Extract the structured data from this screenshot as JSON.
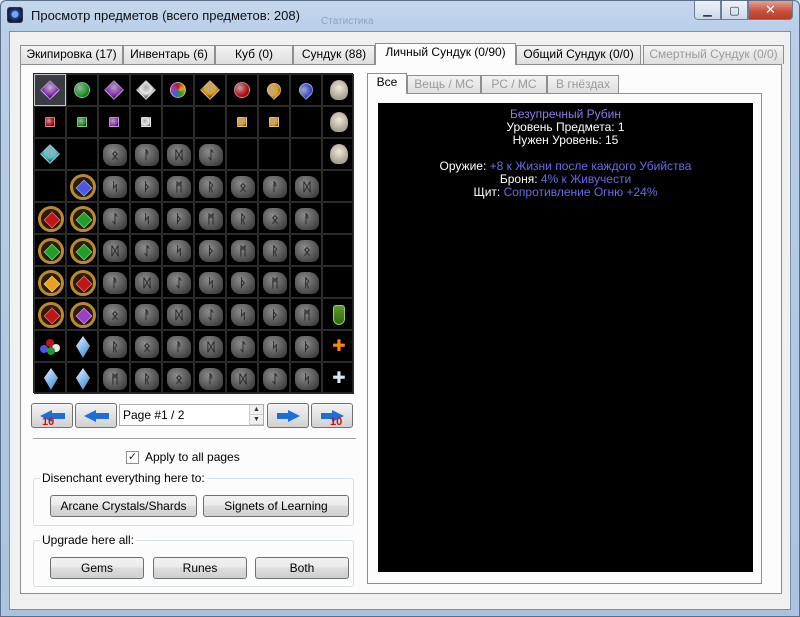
{
  "window": {
    "title": "Просмотр предметов (всего предметов: 208)",
    "ghost_text": "Статистика",
    "min_icon": "minimize-icon",
    "max_icon": "maximize-icon",
    "close_icon": "close-icon"
  },
  "tabs": [
    {
      "label": "Экипировка (17)",
      "state": "normal"
    },
    {
      "label": "Инвентарь (6)",
      "state": "normal"
    },
    {
      "label": "Куб (0)",
      "state": "normal"
    },
    {
      "label": "Сундук (88)",
      "state": "normal"
    },
    {
      "label": "Личный Сундук (0/90)",
      "state": "active"
    },
    {
      "label": "Общий Сундук (0/0)",
      "state": "normal"
    },
    {
      "label": "Смертный Сундук (0/0)",
      "state": "disabled"
    }
  ],
  "grid": {
    "rows": [
      [
        "amethyst-gem",
        "emerald-gem",
        "amethyst-gem",
        "diamond-gem",
        "rainbow-gem",
        "topaz-gem",
        "ruby-gem",
        "topaz-gem",
        "sapphire-gem",
        "skull-gem"
      ],
      [
        "ruby-gem",
        "emerald-gem",
        "amethyst-gem",
        "diamond-gem",
        "",
        "",
        "topaz-gem",
        "topaz-gem",
        "",
        "skull-gem"
      ],
      [
        "aquamarine-gem",
        "",
        "rune",
        "rune",
        "rune",
        "rune",
        "",
        "",
        "",
        "skull-gem"
      ],
      [
        "",
        "amulet-blue",
        "rune",
        "rune",
        "rune",
        "rune",
        "rune",
        "rune",
        "rune",
        ""
      ],
      [
        "amulet-red",
        "amulet-green",
        "rune",
        "rune",
        "rune",
        "rune",
        "rune",
        "rune",
        "rune",
        ""
      ],
      [
        "amulet-green",
        "amulet-green",
        "rune",
        "rune",
        "rune",
        "rune",
        "rune",
        "rune",
        "rune",
        ""
      ],
      [
        "amulet-gold",
        "amulet-red",
        "rune",
        "rune",
        "rune",
        "rune",
        "rune",
        "rune",
        "rune",
        ""
      ],
      [
        "amulet-red",
        "amulet-purple",
        "rune",
        "rune",
        "rune",
        "rune",
        "rune",
        "rune",
        "rune",
        "potion-icon"
      ],
      [
        "stones-icon",
        "crystal-icon",
        "rune",
        "rune",
        "rune",
        "rune",
        "rune",
        "rune",
        "rune",
        "cross-icon"
      ],
      [
        "crystal-icon",
        "crystal-icon",
        "rune",
        "rune",
        "rune",
        "rune",
        "rune",
        "rune",
        "rune",
        "cross-icon"
      ]
    ],
    "rune_glyphs": [
      "ᛟ",
      "ᚨ",
      "ᛞ",
      "ᛇ",
      "ᛋ",
      "ᚦ",
      "ᛗ",
      "ᚱ"
    ]
  },
  "nav": {
    "back10_label": "10",
    "fwd10_label": "10",
    "page_value": "Page #1 / 2"
  },
  "apply": {
    "label": "Apply to all pages",
    "checked": "✓"
  },
  "disenchant": {
    "title": "Disenchant everything here to:",
    "btn1": "Arcane Crystals/Shards",
    "btn2": "Signets of Learning"
  },
  "upgrade": {
    "title": "Upgrade here all:",
    "gems": "Gems",
    "runes": "Runes",
    "both": "Both"
  },
  "right_tabs": [
    {
      "label": "Все",
      "state": "active"
    },
    {
      "label": "Вещь / МС",
      "state": "disabled"
    },
    {
      "label": "РС / МС",
      "state": "disabled"
    },
    {
      "label": "В гнёздах",
      "state": "disabled"
    }
  ],
  "tooltip": {
    "name": "Безупречный Рубин",
    "level_line": "Уровень Предмета: 1",
    "req_line": "Нужен Уровень: 15",
    "weapon_label": "Оружие:",
    "weapon_value": "+8 к Жизни после каждого Убийства",
    "armor_label": "Броня:",
    "armor_value": "4% к Живучести",
    "shield_label": "Щит:",
    "shield_value": "Сопротивление Огню +24%"
  },
  "colors": {
    "ruby": "#c0141a",
    "emerald": "#1f9e2a",
    "amethyst": "#9b3fc4",
    "diamond": "#e8e8e8",
    "topaz": "#e7a11c",
    "sapphire": "#4a58e0",
    "aquamarine": "#4fc8d0"
  }
}
